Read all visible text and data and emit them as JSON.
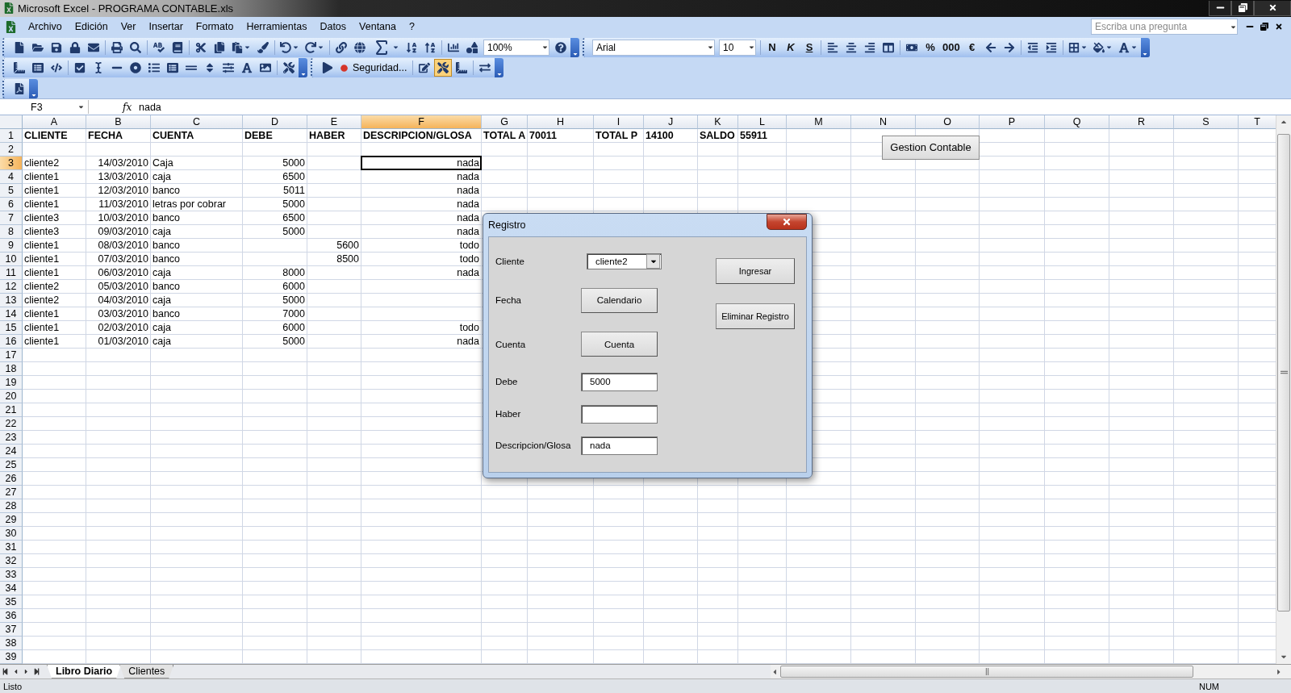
{
  "window": {
    "title": "Microsoft Excel - PROGRAMA CONTABLE.xls"
  },
  "menu": [
    "Archivo",
    "Edición",
    "Ver",
    "Insertar",
    "Formato",
    "Herramientas",
    "Datos",
    "Ventana",
    "?"
  ],
  "help_search": {
    "placeholder": "Escriba una pregunta"
  },
  "standard_toolbar": {
    "zoom": "100%"
  },
  "format_toolbar": {
    "font": "Arial",
    "size": "10",
    "style_buttons": [
      "N",
      "K",
      "S"
    ],
    "number_buttons": [
      "%",
      "000",
      "€"
    ]
  },
  "forms_toolbar": {
    "security_button": "Seguridad...",
    "design_mode": true
  },
  "formula_bar": {
    "cell": "F3",
    "function_label": "fx",
    "value": "nada"
  },
  "sheet": {
    "columns": [
      {
        "label": "A",
        "selected": false
      },
      {
        "label": "B",
        "selected": false
      },
      {
        "label": "C",
        "selected": false
      },
      {
        "label": "D",
        "selected": false
      },
      {
        "label": "E",
        "selected": false
      },
      {
        "label": "F",
        "selected": true
      },
      {
        "label": "G",
        "selected": false
      },
      {
        "label": "H",
        "selected": false
      },
      {
        "label": "I",
        "selected": false
      },
      {
        "label": "J",
        "selected": false
      },
      {
        "label": "K",
        "selected": false
      },
      {
        "label": "L",
        "selected": false
      },
      {
        "label": "M",
        "selected": false
      },
      {
        "label": "N",
        "selected": false
      },
      {
        "label": "O",
        "selected": false
      },
      {
        "label": "P",
        "selected": false
      },
      {
        "label": "Q",
        "selected": false
      },
      {
        "label": "R",
        "selected": false
      },
      {
        "label": "S",
        "selected": false
      },
      {
        "label": "T",
        "selected": false
      }
    ],
    "rows": [
      {
        "number": "1",
        "selected": false,
        "kind": "header",
        "cells": [
          "CLIENTE",
          "FECHA",
          "CUENTA",
          "DEBE",
          "HABER",
          "DESCRIPCION/GLOSA",
          "TOTAL A",
          "70011",
          "TOTAL P",
          "14100",
          "SALDO",
          "55911"
        ]
      },
      {
        "number": "2",
        "selected": false,
        "kind": "data"
      },
      {
        "number": "3",
        "selected": true,
        "kind": "data",
        "cells": [
          "cliente2",
          "14/03/2010",
          "Caja",
          "5000",
          null,
          "nada"
        ]
      },
      {
        "number": "4",
        "selected": false,
        "kind": "data",
        "cells": [
          "cliente1",
          "13/03/2010",
          "caja",
          "6500",
          null,
          "nada"
        ]
      },
      {
        "number": "5",
        "selected": false,
        "kind": "data",
        "cells": [
          "cliente1",
          "12/03/2010",
          "banco",
          "5011",
          null,
          "nada"
        ]
      },
      {
        "number": "6",
        "selected": false,
        "kind": "data",
        "cells": [
          "cliente1",
          "11/03/2010",
          "letras por cobrar",
          "5000",
          null,
          "nada"
        ]
      },
      {
        "number": "7",
        "selected": false,
        "kind": "data",
        "cells": [
          "cliente3",
          "10/03/2010",
          "banco",
          "6500",
          null,
          "nada"
        ]
      },
      {
        "number": "8",
        "selected": false,
        "kind": "data",
        "cells": [
          "cliente3",
          "09/03/2010",
          "caja",
          "5000",
          null,
          "nada"
        ]
      },
      {
        "number": "9",
        "selected": false,
        "kind": "data",
        "cells": [
          "cliente1",
          "08/03/2010",
          "banco",
          null,
          "5600",
          "todo"
        ]
      },
      {
        "number": "10",
        "selected": false,
        "kind": "data",
        "cells": [
          "cliente1",
          "07/03/2010",
          "banco",
          null,
          "8500",
          "todo"
        ]
      },
      {
        "number": "11",
        "selected": false,
        "kind": "data",
        "cells": [
          "cliente1",
          "06/03/2010",
          "caja",
          "8000",
          null,
          "nada"
        ]
      },
      {
        "number": "12",
        "selected": false,
        "kind": "data",
        "cells": [
          "cliente2",
          "05/03/2010",
          "banco",
          "6000"
        ]
      },
      {
        "number": "13",
        "selected": false,
        "kind": "data",
        "cells": [
          "cliente2",
          "04/03/2010",
          "caja",
          "5000"
        ]
      },
      {
        "number": "14",
        "selected": false,
        "kind": "data",
        "cells": [
          "cliente1",
          "03/03/2010",
          "banco",
          "7000"
        ]
      },
      {
        "number": "15",
        "selected": false,
        "kind": "data",
        "cells": [
          "cliente1",
          "02/03/2010",
          "caja",
          "6000",
          null,
          "todo"
        ]
      },
      {
        "number": "16",
        "selected": false,
        "kind": "data",
        "cells": [
          "cliente1",
          "01/03/2010",
          "caja",
          "5000",
          null,
          "nada"
        ]
      },
      {
        "number": "17",
        "selected": false,
        "kind": "data"
      },
      {
        "number": "18",
        "selected": false,
        "kind": "data"
      },
      {
        "number": "19",
        "selected": false,
        "kind": "data"
      },
      {
        "number": "20",
        "selected": false,
        "kind": "data"
      },
      {
        "number": "21",
        "selected": false,
        "kind": "data"
      },
      {
        "number": "22",
        "selected": false,
        "kind": "data"
      },
      {
        "number": "23",
        "selected": false,
        "kind": "data"
      },
      {
        "number": "24",
        "selected": false,
        "kind": "data"
      },
      {
        "number": "25",
        "selected": false,
        "kind": "data"
      },
      {
        "number": "26",
        "selected": false,
        "kind": "data"
      },
      {
        "number": "27",
        "selected": false,
        "kind": "data"
      },
      {
        "number": "28",
        "selected": false,
        "kind": "data"
      },
      {
        "number": "29",
        "selected": false,
        "kind": "data"
      },
      {
        "number": "30",
        "selected": false,
        "kind": "data"
      },
      {
        "number": "31",
        "selected": false,
        "kind": "data"
      },
      {
        "number": "32",
        "selected": false,
        "kind": "data"
      },
      {
        "number": "33",
        "selected": false,
        "kind": "data"
      },
      {
        "number": "34",
        "selected": false,
        "kind": "data"
      },
      {
        "number": "35",
        "selected": false,
        "kind": "data"
      },
      {
        "number": "36",
        "selected": false,
        "kind": "data"
      },
      {
        "number": "37",
        "selected": false,
        "kind": "data"
      },
      {
        "number": "38",
        "selected": false,
        "kind": "data"
      },
      {
        "number": "39",
        "selected": false,
        "kind": "data"
      }
    ],
    "floating_button": "Gestion Contable"
  },
  "dialog": {
    "title": "Registro",
    "fields": [
      {
        "kind": "combo",
        "label": "Cliente",
        "value": "cliente2"
      },
      {
        "kind": "button",
        "label": "Fecha",
        "button": "Calendario"
      },
      {
        "kind": "button",
        "label": "Cuenta",
        "button": "Cuenta"
      },
      {
        "kind": "input",
        "label": "Debe",
        "value": "5000"
      },
      {
        "kind": "input",
        "label": "Haber"
      },
      {
        "kind": "input",
        "label": "Descripcion/Glosa",
        "value": "nada"
      }
    ],
    "actions": [
      "Ingresar",
      "Eliminar Registro"
    ]
  },
  "sheet_tabs": [
    {
      "label": "Libro Diario",
      "selected": true
    },
    {
      "label": "Clientes",
      "selected": false
    }
  ],
  "status_bar": {
    "mode": "Listo",
    "indicator": "NUM"
  }
}
